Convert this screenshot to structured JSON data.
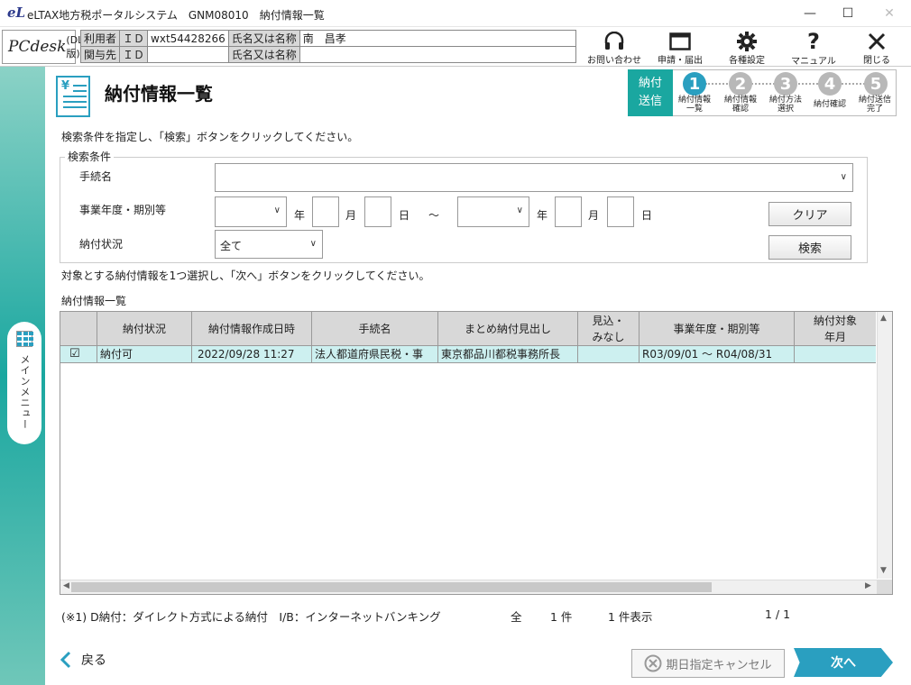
{
  "window": {
    "title": "eLTAX地方税ポータルシステム　GNM08010　納付情報一覧",
    "logo": "eL"
  },
  "header": {
    "pcdesk": "PCdesk",
    "pcdesk_suffix": "(DL版)",
    "user_label": "利用者",
    "involved_label": "関与先",
    "id_label": "ＩＤ",
    "name_label": "氏名又は名称",
    "user_id": "wxt54428266",
    "user_name": "南　昌孝",
    "involved_id": "",
    "involved_name": "",
    "buttons": [
      {
        "label": "お問い合わせ",
        "icon": "headset-icon"
      },
      {
        "label": "申請・届出",
        "icon": "window-icon"
      },
      {
        "label": "各種設定",
        "icon": "gear-icon"
      },
      {
        "label": "マニュアル",
        "icon": "question-icon"
      },
      {
        "label": "閉じる",
        "icon": "close-icon"
      }
    ]
  },
  "sidebar": {
    "menu_label": "メインメニュー"
  },
  "page": {
    "title": "納付情報一覧",
    "instruction1": "検索条件を指定し、「検索」ボタンをクリックしてください。",
    "instruction2": "対象とする納付情報を1つ選択し、「次へ」ボタンをクリックしてください。"
  },
  "steps": {
    "section_line1": "納付",
    "section_line2": "送信",
    "items": [
      {
        "num": "1",
        "l1": "納付情報",
        "l2": "一覧",
        "active": true
      },
      {
        "num": "2",
        "l1": "納付情報",
        "l2": "確認",
        "active": false
      },
      {
        "num": "3",
        "l1": "納付方法",
        "l2": "選択",
        "active": false
      },
      {
        "num": "4",
        "l1": "納付確認",
        "l2": "",
        "active": false
      },
      {
        "num": "5",
        "l1": "納付送信",
        "l2": "完了",
        "active": false
      }
    ],
    "active_color": "#2a9fc0",
    "inactive_color": "#b8b8b8"
  },
  "search": {
    "legend": "検索条件",
    "procedure_label": "手続名",
    "procedure_value": "",
    "period_label": "事業年度・期別等",
    "year_unit": "年",
    "month_unit": "月",
    "day_unit": "日",
    "range_sep": "～",
    "status_label": "納付状況",
    "status_value": "全て",
    "clear_label": "クリア",
    "search_label": "検索"
  },
  "list": {
    "title": "納付情報一覧",
    "columns": [
      "",
      "納付状況",
      "納付情報作成日時",
      "手続名",
      "まとめ納付見出し",
      "見込・\nみなし",
      "事業年度・期別等",
      "納付対象\n年月"
    ],
    "rows": [
      {
        "checked": "☑",
        "status": "納付可",
        "created": "2022/09/28 11:27",
        "procedure": "法人都道府県民税・事",
        "summary": "東京都品川都税事務所長",
        "estimate": "",
        "period": "R03/09/01 ～ R04/08/31",
        "target_month": ""
      }
    ]
  },
  "footer": {
    "note": "(※1) D納付：ダイレクト方式による納付　I/B：インターネットバンキング",
    "total_prefix": "全",
    "total_count": "1 件",
    "shown": "1 件表示",
    "paging": "1 / 1",
    "back_label": "戻る",
    "cancel_label": "期日指定キャンセル",
    "next_label": "次へ"
  }
}
